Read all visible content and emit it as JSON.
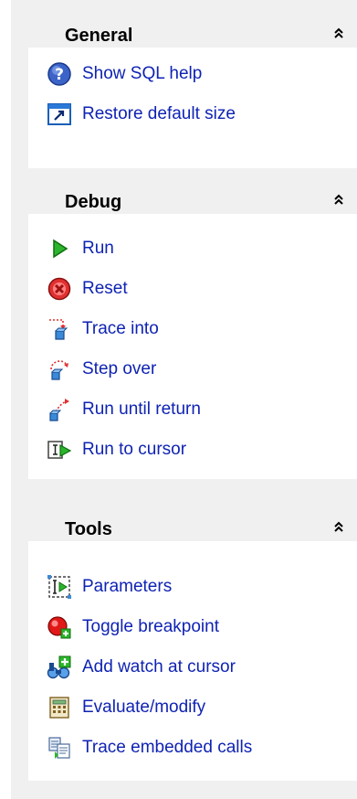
{
  "general": {
    "title": "General",
    "items": [
      {
        "label": "Show SQL help",
        "icon": "help-icon"
      },
      {
        "label": "Restore default size",
        "icon": "restore-window-icon"
      }
    ]
  },
  "debug": {
    "title": "Debug",
    "items": [
      {
        "label": "Run",
        "icon": "run-arrow-icon"
      },
      {
        "label": "Reset",
        "icon": "reset-stop-icon"
      },
      {
        "label": "Trace into",
        "icon": "trace-into-icon"
      },
      {
        "label": "Step over",
        "icon": "step-over-icon"
      },
      {
        "label": "Run until return",
        "icon": "run-until-return-icon"
      },
      {
        "label": "Run to cursor",
        "icon": "run-to-cursor-icon"
      }
    ]
  },
  "tools": {
    "title": "Tools",
    "items": [
      {
        "label": "Parameters",
        "icon": "parameters-icon"
      },
      {
        "label": "Toggle breakpoint",
        "icon": "breakpoint-icon"
      },
      {
        "label": "Add watch at cursor",
        "icon": "add-watch-icon"
      },
      {
        "label": "Evaluate/modify",
        "icon": "calculator-icon"
      },
      {
        "label": "Trace embedded calls",
        "icon": "trace-calls-icon"
      }
    ]
  },
  "colors": {
    "link": "#0f23b3",
    "pane_background": "#f0f0f0",
    "section_background": "#ffffff"
  }
}
